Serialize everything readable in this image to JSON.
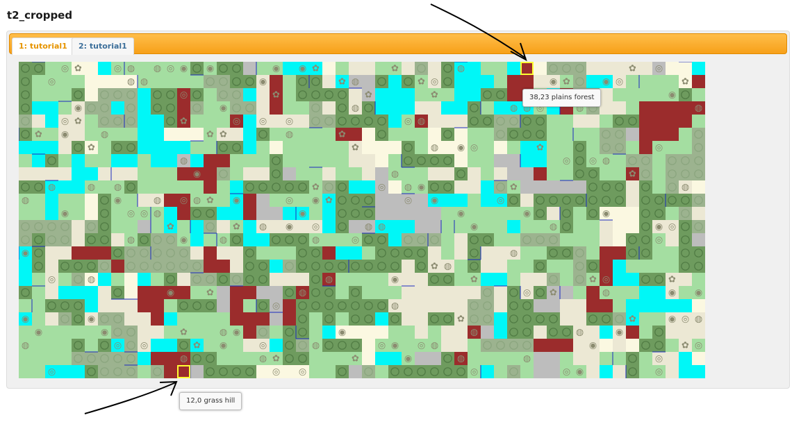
{
  "page": {
    "title": "t2_cropped"
  },
  "tabs": [
    {
      "label": "1: tutorial1",
      "active": true
    },
    {
      "label": "2: tutorial1",
      "active": false
    }
  ],
  "map": {
    "columns": 52,
    "rows": 24,
    "terrain_colors": {
      "grassland": "#a4dea1",
      "plains": "#ece8d4",
      "forest": "#6e9b5e",
      "hills": "#9cb38f",
      "ocean": "#00f7f7",
      "desert": "#fbf8e1",
      "mountains": "#9b2c2c",
      "tundra": "#bdbdbd",
      "border": "#1b2bbf"
    },
    "highlight_color": "#ffff33",
    "highlighted_tiles": [
      "38,23",
      "12,0"
    ]
  },
  "tooltips": {
    "top": "38,23 plains forest",
    "bottom": "12,0 grass hill"
  },
  "colors": {
    "tabbar": "#f7a019",
    "active_tab_text": "#e69400",
    "inactive_tab_text": "#3d6f9a",
    "annotation_arrow": "#000000"
  }
}
